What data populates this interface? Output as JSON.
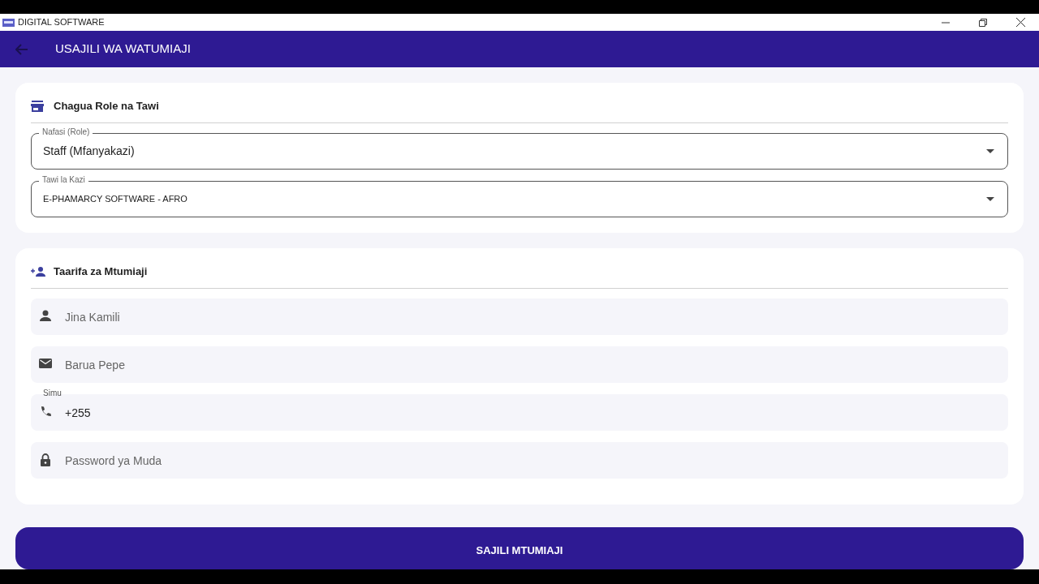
{
  "window": {
    "title": "DIGITAL SOFTWARE"
  },
  "app_bar": {
    "title": "USAJILI WA WATUMIAJI"
  },
  "role_section": {
    "title": "Chagua Role na Tawi",
    "dropdowns": [
      {
        "label": "Nafasi (Role)",
        "value": "Staff (Mfanyakazi)"
      },
      {
        "label": "Tawi la Kazi",
        "value": "E-PHAMARCY SOFTWARE - AFRO"
      }
    ]
  },
  "user_section": {
    "title": "Taarifa za Mtumiaji",
    "fields": [
      {
        "placeholder": "Jina Kamili"
      },
      {
        "placeholder": "Barua Pepe"
      },
      {
        "label": "Simu",
        "value": "+255"
      },
      {
        "placeholder": "Password ya Muda"
      }
    ]
  },
  "submit_button": "SAJILI MTUMIAJI"
}
